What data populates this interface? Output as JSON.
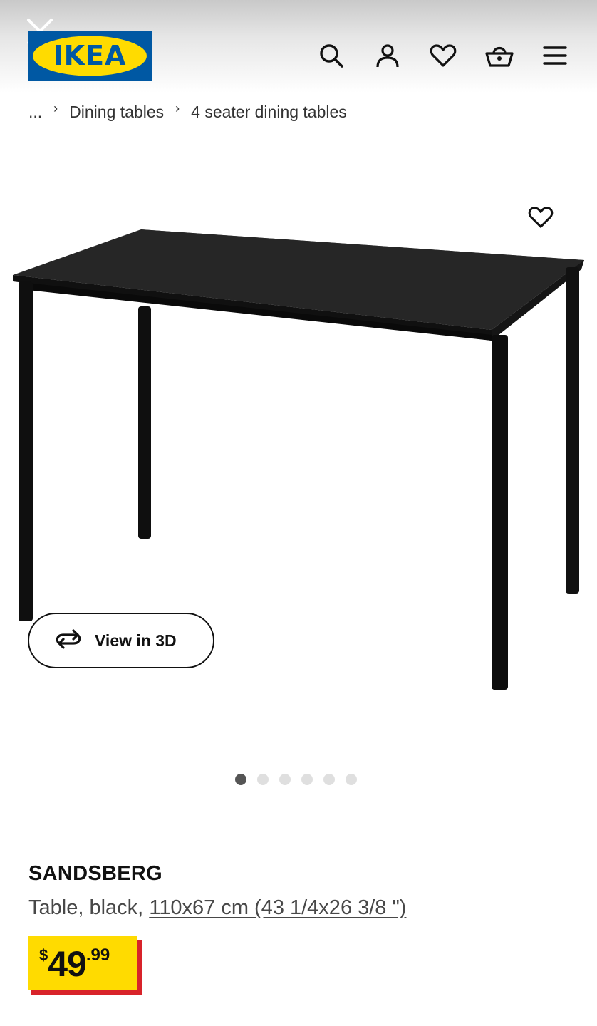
{
  "header": {
    "logo_text": "IKEA",
    "icons": [
      "close-icon",
      "search-icon",
      "account-icon",
      "heart-icon",
      "basket-icon",
      "menu-icon"
    ]
  },
  "breadcrumb": {
    "ellipsis": "...",
    "items": [
      "Dining tables",
      "4 seater dining tables"
    ]
  },
  "gallery": {
    "view_3d_label": "View in 3D",
    "image_count": 6,
    "active_index": 0
  },
  "product": {
    "name": "SANDSBERG",
    "description_prefix": "Table, black, ",
    "dimensions_link": "110x67 cm (43 1/4x26 3/8 \")",
    "price": {
      "currency": "$",
      "integer": "49",
      "decimal": ".99"
    }
  },
  "colors": {
    "brand_blue": "#0058a3",
    "brand_yellow": "#ffdb00",
    "price_red": "#d8232a"
  }
}
